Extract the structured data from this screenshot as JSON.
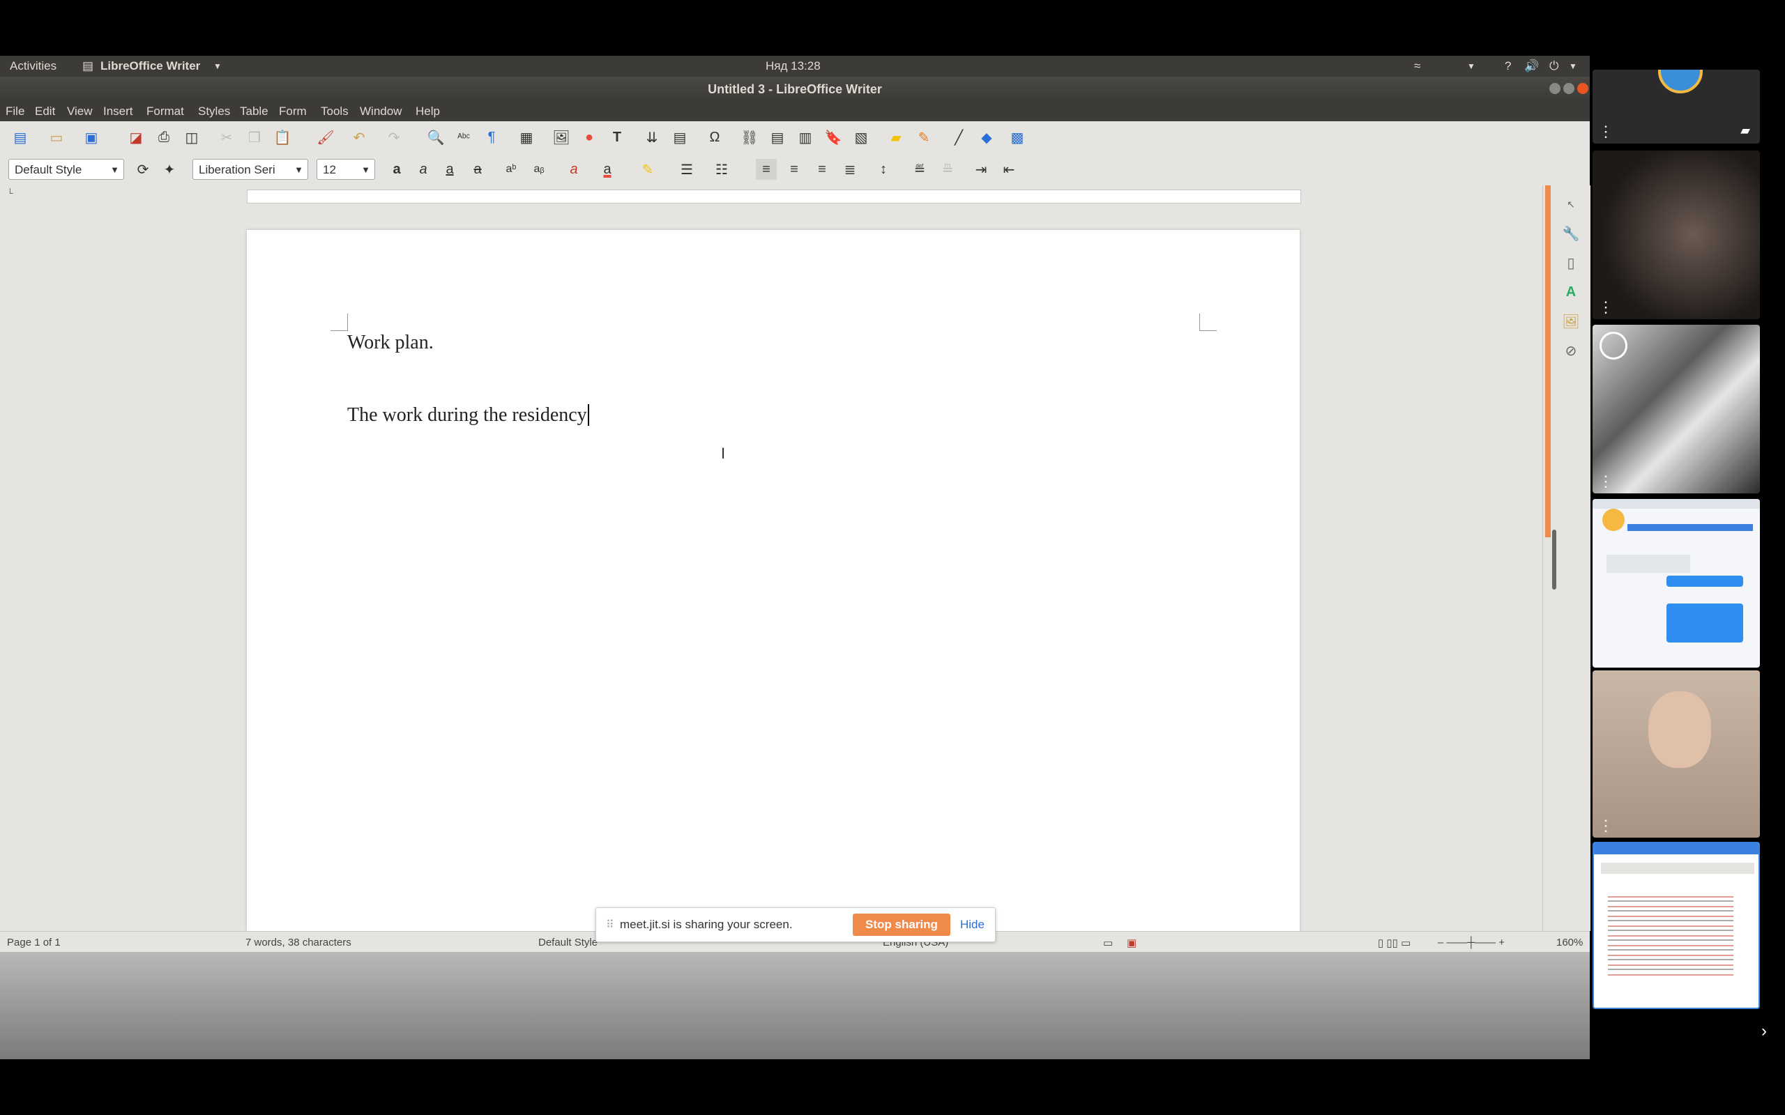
{
  "topbar": {
    "activities": "Activities",
    "app_menu": "LibreOffice Writer",
    "clock": "Няд 13:28"
  },
  "window": {
    "title": "Untitled 3 - LibreOffice Writer"
  },
  "menu": [
    "File",
    "Edit",
    "View",
    "Insert",
    "Format",
    "Styles",
    "Table",
    "Form",
    "Tools",
    "Window",
    "Help"
  ],
  "formatting": {
    "paragraph_style": "Default Style",
    "font_name": "Liberation Seri",
    "font_size": "12"
  },
  "document": {
    "line1": "Work plan.",
    "line2": "The work during the residency"
  },
  "statusbar": {
    "page": "Page 1 of 1",
    "words": "7 words, 38 characters",
    "style": "Default Style",
    "language": "English (USA)",
    "zoom": "160%"
  },
  "share_banner": {
    "message": "meet.jit.si is sharing your screen.",
    "stop_label": "Stop sharing",
    "hide_label": "Hide"
  },
  "colors": {
    "accent": "#f08a4b",
    "link": "#2a6fd6",
    "ubuntu_panel": "#3c3b37"
  }
}
